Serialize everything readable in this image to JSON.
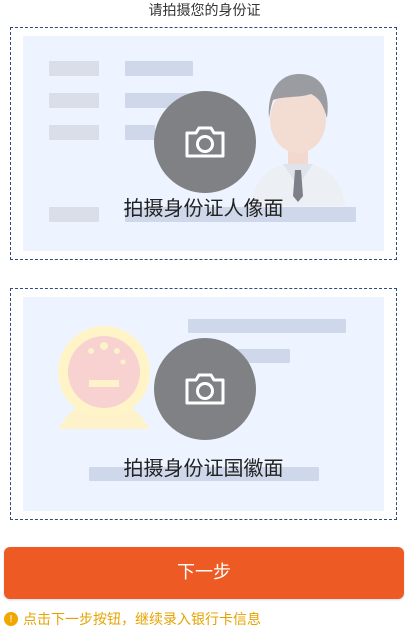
{
  "header": {
    "instruction": "请拍摄您的身份证"
  },
  "cards": {
    "front": {
      "label": "拍摄身份证人像面",
      "camera_icon": "camera-icon",
      "illustration_icon": "person-portrait-icon"
    },
    "back": {
      "label": "拍摄身份证国徽面",
      "camera_icon": "camera-icon",
      "illustration_icon": "national-emblem-icon"
    }
  },
  "actions": {
    "next_label": "下一步"
  },
  "hint": {
    "icon": "info-icon",
    "icon_glyph": "!",
    "text": "点击下一步按钮，继续录入银行卡信息"
  },
  "colors": {
    "accent": "#ee5a23",
    "hint": "#e6a300",
    "camera_circle": "#7f8185",
    "card_background": "#eef4ff"
  }
}
